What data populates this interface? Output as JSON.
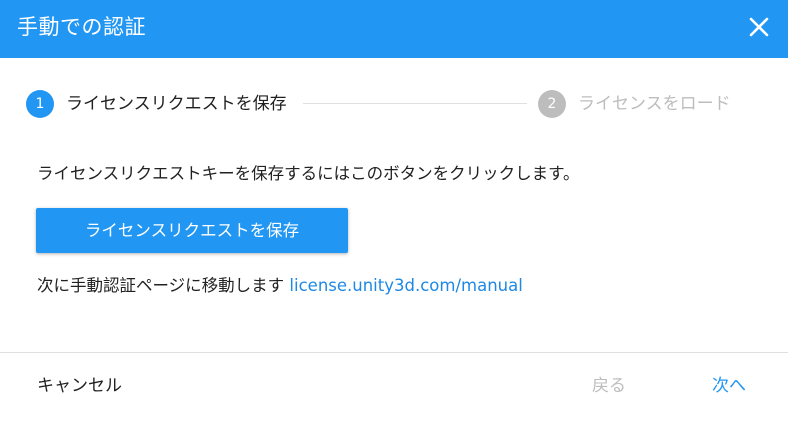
{
  "dialog": {
    "title": "手動での認証",
    "close_icon": "close-icon"
  },
  "stepper": {
    "steps": [
      {
        "number": "1",
        "label": "ライセンスリクエストを保存",
        "state": "active"
      },
      {
        "number": "2",
        "label": "ライセンスをロード",
        "state": "inactive"
      }
    ]
  },
  "content": {
    "instruction": "ライセンスリクエストキーを保存するにはこのボタンをクリックします。",
    "save_button_label": "ライセンスリクエストを保存",
    "next_text": "次に手動認証ページに移動します",
    "manual_link": "license.unity3d.com/manual"
  },
  "footer": {
    "cancel_label": "キャンセル",
    "back_label": "戻る",
    "next_label": "次へ"
  },
  "colors": {
    "accent": "#2196f3",
    "link": "#1e88e5",
    "disabled": "#bdbdbd",
    "text": "#212121"
  }
}
